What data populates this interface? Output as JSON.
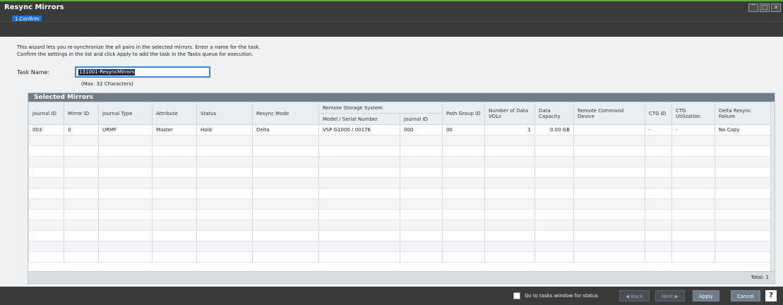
{
  "window": {
    "title": "Resync Mirrors",
    "step": "1.Confirm",
    "controls": [
      "minimize-icon",
      "maximize-icon",
      "close-icon"
    ]
  },
  "intro": {
    "line1": "This wizard lets you re-synchronize the all pairs in the selected mirrors. Enter a name for the task.",
    "line2": "Confirm the settings in the list and click Apply to add the task  in the Tasks queue for execution."
  },
  "task": {
    "label": "Task Name:",
    "value": "131001-ResyncMirrors",
    "hint": "(Max. 32 Characters)"
  },
  "selected_mirrors": {
    "title": "Selected Mirrors",
    "remote_group": "Remote Storage System",
    "columns": {
      "journal_id": "Journal ID",
      "mirror_id": "Mirror ID",
      "journal_type": "Journal Type",
      "attribute": "Attribute",
      "status": "Status",
      "resync_mode": "Resync Mode",
      "model_serial": "Model / Serial Number",
      "remote_journal_id": "Journal ID",
      "path_group_id": "Path Group ID",
      "num_data_vols": "Number of Data VOLs",
      "data_capacity": "Data Capacity",
      "remote_command_device": "Remote Command Device",
      "ctg_id": "CTG ID",
      "ctg_util": "CTG Utilization",
      "delta_failure": "Delta Resync Failure"
    },
    "rows": [
      {
        "journal_id": "003",
        "mirror_id": "0",
        "journal_type": "URMF",
        "attribute": "Master",
        "status": "Hold",
        "resync_mode": "Delta",
        "model_serial": "VSP G1000 / 00176",
        "remote_journal_id": "000",
        "path_group_id": "00",
        "num_data_vols": "1",
        "data_capacity": "0.00 GB",
        "remote_command_device": "",
        "ctg_id": "-",
        "ctg_util": "-",
        "delta_failure": "No Copy"
      }
    ],
    "total": "Total:  1"
  },
  "bottom": {
    "checkbox_label": "Go to tasks window for status",
    "back": "◀ Back",
    "next": "Next ▶",
    "apply": "Apply",
    "cancel": "Cancel",
    "help": "?"
  }
}
